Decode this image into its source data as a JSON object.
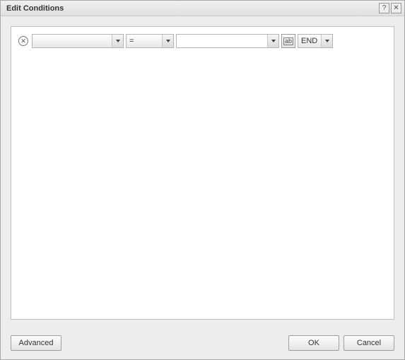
{
  "dialog": {
    "title": "Edit Conditions"
  },
  "condition": {
    "field": "",
    "operator": "=",
    "value": "",
    "ab_label": "ab",
    "logical": "END"
  },
  "buttons": {
    "advanced": "Advanced",
    "ok": "OK",
    "cancel": "Cancel"
  }
}
